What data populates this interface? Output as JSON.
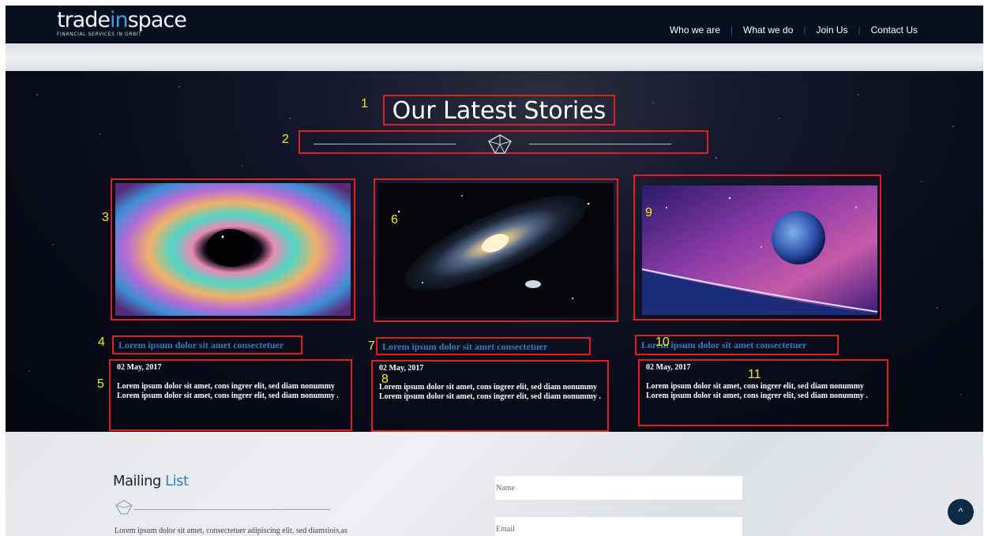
{
  "header": {
    "logo_prefix": "trade",
    "logo_accent": "in",
    "logo_suffix": "space",
    "logo_tagline": "FINANCIAL SERVICES IN ORBIT",
    "nav": [
      "Who we are",
      "What we do",
      "Join Us",
      "Contact Us"
    ],
    "nav_separator": "|"
  },
  "stories": {
    "title": "Our Latest Stories",
    "markers": [
      "1",
      "2",
      "3",
      "4",
      "5",
      "6",
      "7",
      "8",
      "9",
      "10",
      "11"
    ],
    "cards": [
      {
        "title": "Lorem ipsum dolor sit amet consectetuer",
        "date": "02 May, 2017",
        "text": "Lorem ipsum dolor sit amet, cons ingrer elit, sed diam nonummy Lorem ipsum dolor sit amet, cons ingrer elit, sed diam nonummy .",
        "image": "nebula-vortex"
      },
      {
        "title": "Lorem ipsum dolor sit amet consectetuer",
        "date": "02 May, 2017",
        "text": "Lorem ipsum dolor sit amet, cons ingrer elit, sed diam nonummy Lorem ipsum dolor sit amet, cons ingrer elit, sed diam nonummy .",
        "image": "spiral-galaxy"
      },
      {
        "title": "Lorem ipsum dolor sit amet consectetuer",
        "date": "02 May, 2017",
        "text": "Lorem ipsum dolor sit amet, cons ingrer elit, sed diam nonummy Lorem ipsum dolor sit amet, cons ingrer elit, sed diam nonummy .",
        "image": "planet-horizon"
      }
    ]
  },
  "mailing": {
    "title_main": "Mailing",
    "title_accent": "List",
    "text": "Lorem ipsum dolor sit amet, consectetuer adipiscing elit, sed diamsiois,as",
    "name_placeholder": "Name",
    "email_placeholder": "Email"
  },
  "back_to_top": "^",
  "colors": {
    "accent": "#2f7fc1",
    "header_bg": "#06101e",
    "annotation_box": "#e02020",
    "annotation_number": "#f5f000"
  }
}
